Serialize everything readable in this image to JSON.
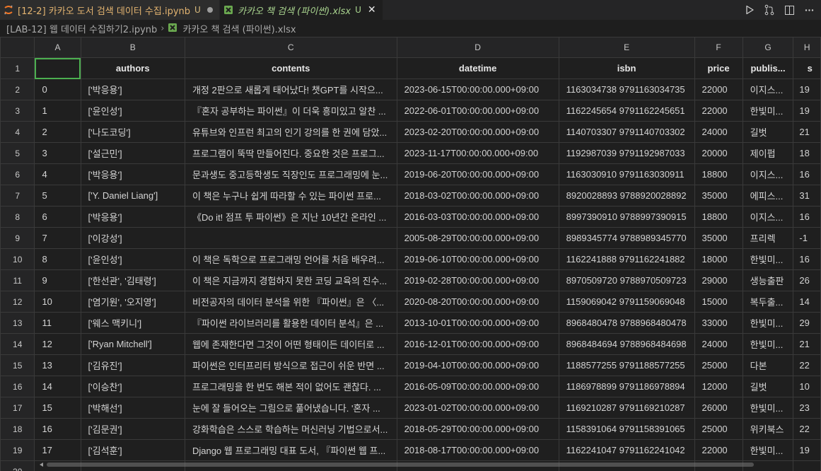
{
  "tabs": [
    {
      "label": "[12-2] 카카오 도서 검색 데이터 수집.ipynb",
      "status": "U",
      "icon": "jupyter-notebook-icon",
      "active": false
    },
    {
      "label": "카카오 책 검색 (파이썬).xlsx",
      "status": "U",
      "icon": "excel-file-icon",
      "active": true
    }
  ],
  "editor_actions": [
    "run-icon",
    "compare-changes-icon",
    "split-editor-icon",
    "more-actions-icon"
  ],
  "breadcrumb": {
    "items": [
      "[LAB-12] 웹 데이터 수집하기2.ipynb",
      "카카오 책 검색 (파이썬).xlsx"
    ]
  },
  "sheet": {
    "column_letters": [
      "A",
      "B",
      "C",
      "D",
      "E",
      "F",
      "G",
      "H"
    ],
    "header_row_number": "1",
    "headers": [
      "",
      "authors",
      "contents",
      "datetime",
      "isbn",
      "price",
      "publis...",
      "s"
    ],
    "rows": [
      {
        "n": "2",
        "cells": [
          "0",
          "['박응용']",
          "개정 2판으로 새롭게 태어났다! 챗GPT를 시작으...",
          "2023-06-15T00:00:00.000+09:00",
          "1163034738 9791163034735",
          "22000",
          "이지스...",
          "19"
        ]
      },
      {
        "n": "3",
        "cells": [
          "1",
          "['윤인성']",
          "『혼자 공부하는 파이썬』이 더욱 흥미있고 알찬 ...",
          "2022-06-01T00:00:00.000+09:00",
          "1162245654 9791162245651",
          "22000",
          "한빛미...",
          "19"
        ]
      },
      {
        "n": "4",
        "cells": [
          "2",
          "['나도코딩']",
          "유튜브와 인프런 최고의 인기 강의를 한 권에 담았...",
          "2023-02-20T00:00:00.000+09:00",
          "1140703307 9791140703302",
          "24000",
          "길벗",
          "21"
        ]
      },
      {
        "n": "5",
        "cells": [
          "3",
          "['설근민']",
          "프로그램이 뚝딱 만들어진다. 중요한 것은 프로그...",
          "2023-11-17T00:00:00.000+09:00",
          "1192987039 9791192987033",
          "20000",
          "제이펍",
          "18"
        ]
      },
      {
        "n": "6",
        "cells": [
          "4",
          "['박응용']",
          "문과생도 중고등학생도 직장인도 프로그래밍에 눈...",
          "2019-06-20T00:00:00.000+09:00",
          "1163030910 9791163030911",
          "18800",
          "이지스...",
          "16"
        ]
      },
      {
        "n": "7",
        "cells": [
          "5",
          "['Y. Daniel Liang']",
          "이 책은 누구나 쉽게 따라할 수 있는 파이썬 프로...",
          "2018-03-02T00:00:00.000+09:00",
          "8920028893 9788920028892",
          "35000",
          "에피스...",
          "31"
        ]
      },
      {
        "n": "8",
        "cells": [
          "6",
          "['박응용']",
          "《Do it! 점프 투 파이썬》은 지난 10년간 온라인 ...",
          "2016-03-03T00:00:00.000+09:00",
          "8997390910 9788997390915",
          "18800",
          "이지스...",
          "16"
        ]
      },
      {
        "n": "9",
        "cells": [
          "7",
          "['이강성']",
          "",
          "2005-08-29T00:00:00.000+09:00",
          "8989345774 9788989345770",
          "35000",
          "프리렉",
          "-1"
        ]
      },
      {
        "n": "10",
        "cells": [
          "8",
          "['윤인성']",
          "이 책은 독학으로 프로그래밍 언어를 처음 배우려...",
          "2019-06-10T00:00:00.000+09:00",
          "1162241888 9791162241882",
          "18000",
          "한빛미...",
          "16"
        ]
      },
      {
        "n": "11",
        "cells": [
          "9",
          "['한선관', '김태령']",
          "이 책은 지금까지 경험하지 못한 코딩 교육의 진수...",
          "2019-02-28T00:00:00.000+09:00",
          "8970509720 9788970509723",
          "29000",
          "생능출판",
          "26"
        ]
      },
      {
        "n": "12",
        "cells": [
          "10",
          "['염기원', '오지영']",
          "비전공자의 데이터 분석을 위한 『파이썬』은 〈...",
          "2020-08-20T00:00:00.000+09:00",
          "1159069042 9791159069048",
          "15000",
          "복두출...",
          "14"
        ]
      },
      {
        "n": "13",
        "cells": [
          "11",
          "['웨스 맥키니']",
          "『파이썬 라이브러리를 활용한 데이터 분석』은 ...",
          "2013-10-01T00:00:00.000+09:00",
          "8968480478 9788968480478",
          "33000",
          "한빛미...",
          "29"
        ]
      },
      {
        "n": "14",
        "cells": [
          "12",
          "['Ryan Mitchell']",
          "웹에 존재한다면 그것이 어떤 형태이든 데이터로 ...",
          "2016-12-01T00:00:00.000+09:00",
          "8968484694 9788968484698",
          "24000",
          "한빛미...",
          "21"
        ]
      },
      {
        "n": "15",
        "cells": [
          "13",
          "['김유진']",
          "파이썬은 인터프리터 방식으로 접근이 쉬운 반면 ...",
          "2019-04-10T00:00:00.000+09:00",
          "1188577255 9791188577255",
          "25000",
          "다본",
          "22"
        ]
      },
      {
        "n": "16",
        "cells": [
          "14",
          "['이승찬']",
          "프로그래밍을 한 번도 해본 적이 없어도 괜찮다. ...",
          "2016-05-09T00:00:00.000+09:00",
          "1186978899 9791186978894",
          "12000",
          "길벗",
          "10"
        ]
      },
      {
        "n": "17",
        "cells": [
          "15",
          "['박해선']",
          "눈에 잘 들어오는 그림으로 풀어냈습니다. '혼자 ...",
          "2023-01-02T00:00:00.000+09:00",
          "1169210287 9791169210287",
          "26000",
          "한빛미...",
          "23"
        ]
      },
      {
        "n": "18",
        "cells": [
          "16",
          "['김문권']",
          "강화학습은 스스로 학습하는 머신러닝 기법으로서...",
          "2018-05-29T00:00:00.000+09:00",
          "1158391064 9791158391065",
          "25000",
          "위키북스",
          "22"
        ]
      },
      {
        "n": "19",
        "cells": [
          "17",
          "['김석훈']",
          "Django 웹 프로그래밍 대표 도서, 『파이썬 웹 프...",
          "2018-08-17T00:00:00.000+09:00",
          "1162241047 9791162241042",
          "22000",
          "한빛미...",
          "19"
        ]
      }
    ],
    "partial_row_number": "20"
  },
  "colors": {
    "selection_outline": "#4caf50",
    "modified_notebook_tab": "#e2b370",
    "modified_excel_tab": "#a9d48f"
  }
}
